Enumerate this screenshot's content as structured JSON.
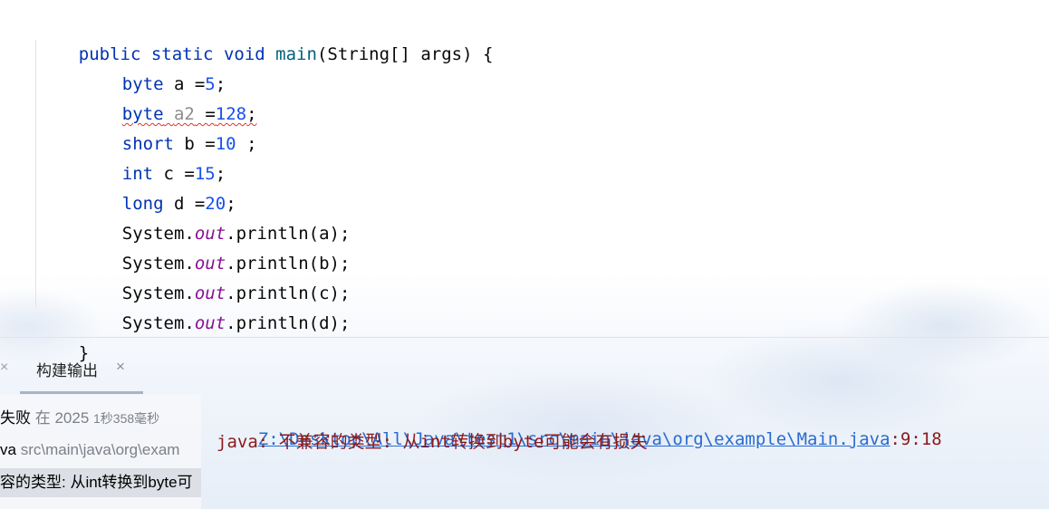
{
  "editor": {
    "lines": [
      {
        "seg": [
          "public",
          " ",
          "static",
          " ",
          "void",
          " ",
          "main",
          "(String[] args) {"
        ]
      },
      {
        "seg": [
          "byte",
          " a =",
          "5",
          ";"
        ]
      },
      {
        "seg": [
          "byte",
          " ",
          "a2",
          " =",
          "128",
          ";"
        ]
      },
      {
        "seg": [
          "short",
          " b =",
          "10",
          " ;"
        ]
      },
      {
        "seg": [
          "int",
          " c =",
          "15",
          ";"
        ]
      },
      {
        "seg": [
          "long",
          " d =",
          "20",
          ";"
        ]
      },
      {
        "seg": [
          "System.",
          "out",
          ".println(a);"
        ]
      },
      {
        "seg": [
          "System.",
          "out",
          ".println(b);"
        ]
      },
      {
        "seg": [
          "System.",
          "out",
          ".println(c);"
        ]
      },
      {
        "seg": [
          "System.",
          "out",
          ".println(d);"
        ]
      },
      {
        "seg": [
          "}"
        ]
      }
    ]
  },
  "build_panel": {
    "prev_tab_close": "×",
    "tab_label": "构建输出",
    "tab_close": "×",
    "tree": {
      "row1_status": "失败",
      "row1_time_prefix": "在 2025",
      "row1_duration": "1秒358毫秒",
      "row2_name": "va",
      "row2_path": "src\\main\\java\\org\\exam",
      "row3_text": "容的类型: 从int转换到byte可"
    },
    "output": {
      "path_link": "Z:\\Desktop\\All\\Java\\test1\\src\\main\\java\\org\\example\\Main.java",
      "position": ":9:18",
      "message": "java: 不兼容的类型: 从int转换到byte可能会有损失"
    }
  },
  "colors": {
    "keyword": "#0033b3",
    "number": "#1750eb",
    "static_field": "#871094",
    "error_text": "#8b1a1a",
    "link": "#2a6bd0"
  }
}
